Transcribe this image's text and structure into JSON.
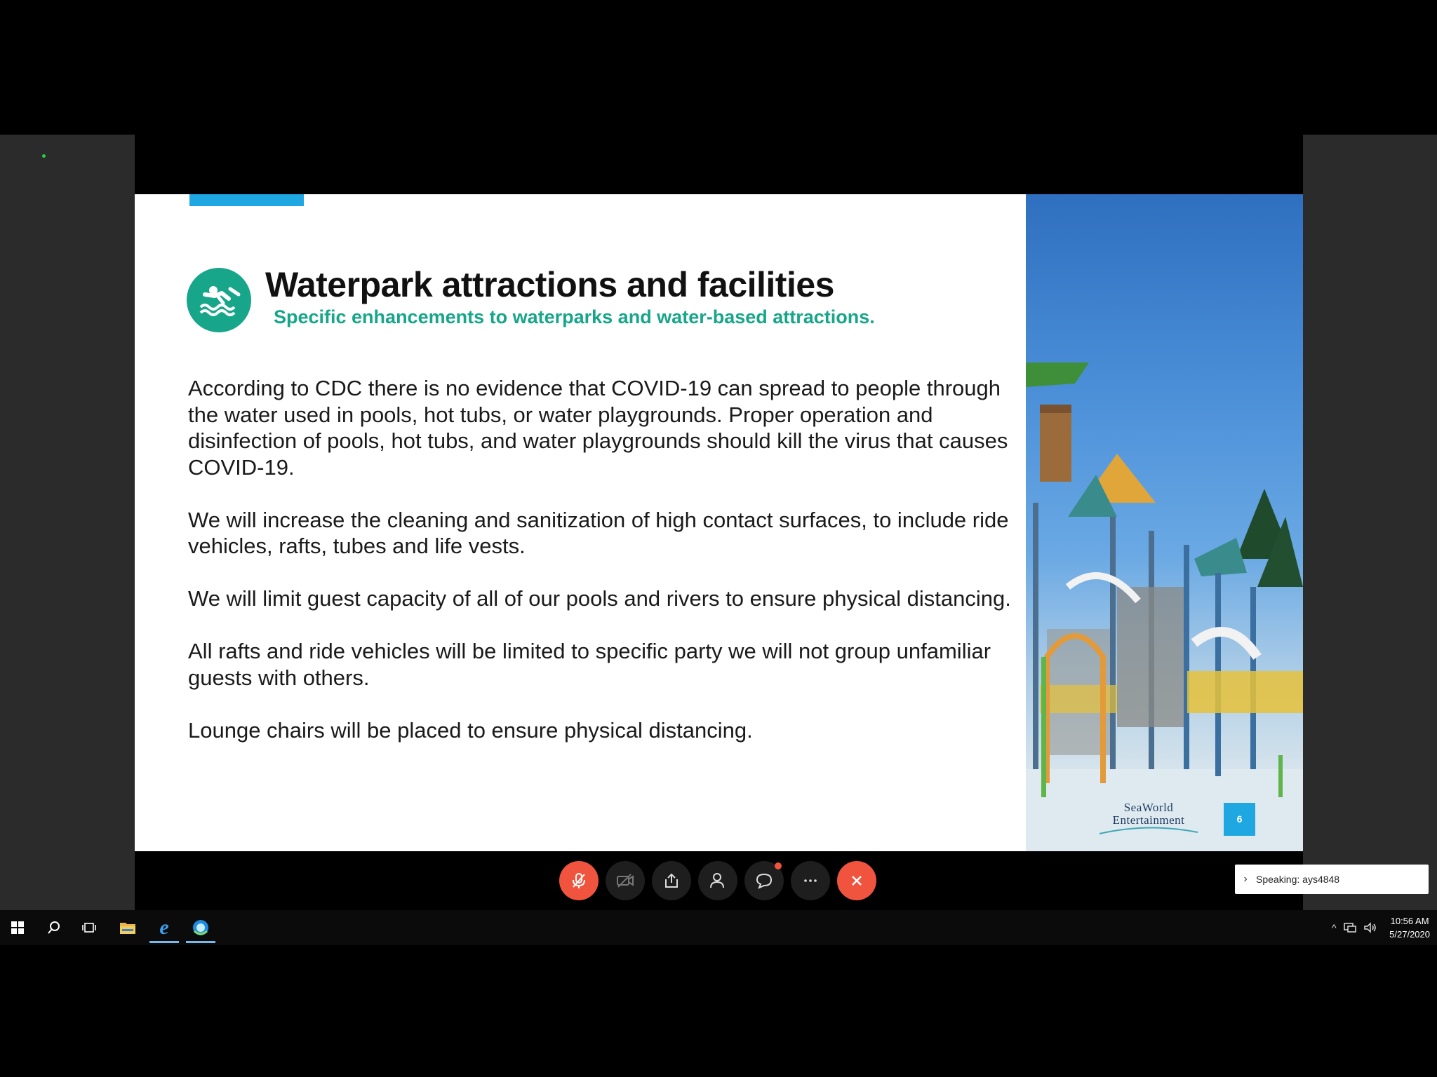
{
  "slide": {
    "title": "Waterpark attractions and facilities",
    "subtitle": "Specific enhancements to waterparks and water-based attractions.",
    "paragraphs": [
      "According to CDC there is no evidence that COVID-19 can spread to people through the water used in pools, hot tubs, or water playgrounds. Proper operation and disinfection of pools, hot tubs, and water playgrounds should kill the virus that causes COVID-19.",
      "We will increase the cleaning and sanitization of high contact surfaces, to include ride vehicles, rafts, tubes and life vests.",
      "We will limit guest capacity of all of our pools and rivers to ensure physical distancing.",
      "All rafts and ride vehicles will be limited to specific party we will not group unfamiliar guests with others.",
      "Lounge chairs will be placed to ensure physical distancing."
    ],
    "logo_line1": "SeaWorld",
    "logo_line2": "Entertainment",
    "page_number": "6",
    "title_icon": "swimmer-icon",
    "accent_color": "#17a689",
    "bar_color": "#1ea7e0"
  },
  "toolbar": {
    "buttons": [
      {
        "name": "mute-button",
        "icon": "microphone-muted-icon"
      },
      {
        "name": "video-button",
        "icon": "video-off-icon"
      },
      {
        "name": "share-button",
        "icon": "share-icon"
      },
      {
        "name": "participants-button",
        "icon": "participants-icon"
      },
      {
        "name": "chat-button",
        "icon": "chat-icon"
      },
      {
        "name": "more-button",
        "icon": "more-icon"
      },
      {
        "name": "leave-button",
        "icon": "close-icon"
      }
    ],
    "danger_color": "#f0543f"
  },
  "speaking": {
    "text": "Speaking: ays4848"
  },
  "taskbar": {
    "time": "10:56 AM",
    "date": "5/27/2020",
    "icons": [
      "windows-start-icon",
      "search-icon",
      "task-view-icon",
      "file-explorer-icon",
      "internet-explorer-icon",
      "webex-icon"
    ]
  }
}
